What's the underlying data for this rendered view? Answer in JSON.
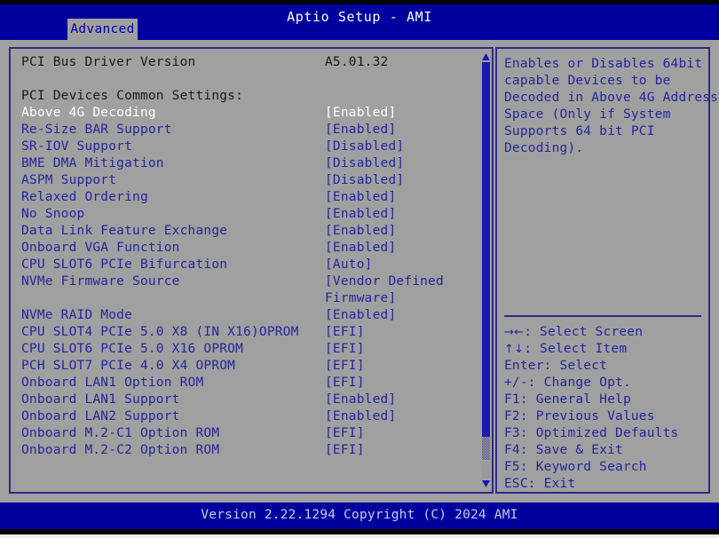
{
  "window": {
    "title": "Aptio Setup - AMI",
    "active_tab": "Advanced"
  },
  "main": {
    "rows": [
      {
        "label": "PCI Bus Driver Version",
        "value": "A5.01.32",
        "style": "info"
      },
      {
        "label": "",
        "value": "",
        "style": "spacer"
      },
      {
        "label": "PCI Devices Common Settings:",
        "value": "",
        "style": "header"
      },
      {
        "label": "Above 4G Decoding",
        "value": "[Enabled]",
        "style": "selected"
      },
      {
        "label": "Re-Size BAR Support",
        "value": "[Enabled]",
        "style": "normal"
      },
      {
        "label": "SR-IOV Support",
        "value": "[Disabled]",
        "style": "normal"
      },
      {
        "label": "BME DMA Mitigation",
        "value": "[Disabled]",
        "style": "normal"
      },
      {
        "label": "ASPM Support",
        "value": "[Disabled]",
        "style": "normal"
      },
      {
        "label": "Relaxed Ordering",
        "value": "[Enabled]",
        "style": "normal"
      },
      {
        "label": "No Snoop",
        "value": "[Enabled]",
        "style": "normal"
      },
      {
        "label": "Data Link Feature Exchange",
        "value": "[Enabled]",
        "style": "normal"
      },
      {
        "label": "Onboard VGA Function",
        "value": "[Enabled]",
        "style": "normal"
      },
      {
        "label": "CPU SLOT6 PCIe Bifurcation",
        "value": "[Auto]",
        "style": "normal"
      },
      {
        "label": "NVMe Firmware Source",
        "value": "[Vendor Defined",
        "style": "normal"
      },
      {
        "label": "",
        "value": "Firmware]",
        "style": "continuation"
      },
      {
        "label": "NVMe RAID Mode",
        "value": "[Enabled]",
        "style": "normal"
      },
      {
        "label": "CPU SLOT4 PCIe 5.0 X8 (IN X16)OPROM",
        "value": "[EFI]",
        "style": "normal"
      },
      {
        "label": "CPU SLOT6 PCIe 5.0 X16 OPROM",
        "value": "[EFI]",
        "style": "normal"
      },
      {
        "label": "PCH SLOT7 PCIe 4.0 X4 OPROM",
        "value": "[EFI]",
        "style": "normal"
      },
      {
        "label": "Onboard LAN1 Option ROM",
        "value": "[EFI]",
        "style": "normal"
      },
      {
        "label": "Onboard LAN1 Support",
        "value": "[Enabled]",
        "style": "normal"
      },
      {
        "label": "Onboard LAN2 Support",
        "value": "[Enabled]",
        "style": "normal"
      },
      {
        "label": "Onboard M.2-C1 Option ROM",
        "value": "[EFI]",
        "style": "normal"
      },
      {
        "label": "Onboard M.2-C2 Option ROM",
        "value": "[EFI]",
        "style": "normal"
      }
    ]
  },
  "help": {
    "lines": [
      "Enables or Disables 64bit",
      "capable Devices to be",
      "Decoded in Above 4G Address",
      "Space (Only if System",
      "Supports 64 bit PCI",
      "Decoding)."
    ],
    "keys": [
      {
        "glyph": "→←",
        "text": ": Select Screen"
      },
      {
        "glyph": "↑↓",
        "text": ": Select Item"
      },
      {
        "glyph": "",
        "text": "Enter: Select"
      },
      {
        "glyph": "",
        "text": "+/-: Change Opt."
      },
      {
        "glyph": "",
        "text": "F1: General Help"
      },
      {
        "glyph": "",
        "text": "F2: Previous Values"
      },
      {
        "glyph": "",
        "text": "F3: Optimized Defaults"
      },
      {
        "glyph": "",
        "text": "F4: Save & Exit"
      },
      {
        "glyph": "",
        "text": "F5: Keyword Search"
      },
      {
        "glyph": "",
        "text": "ESC: Exit"
      }
    ]
  },
  "footer": {
    "text": "Version 2.22.1294 Copyright (C) 2024 AMI"
  },
  "colors": {
    "bios_blue": "#00009e",
    "panel_gray": "#a0a0a0",
    "text_blue": "#26269c",
    "selected_white": "#ffffff",
    "border_blue": "#2a2a8c"
  },
  "scrollbar": {
    "up_icon": "triangle-up-icon",
    "down_icon": "triangle-down-icon"
  }
}
